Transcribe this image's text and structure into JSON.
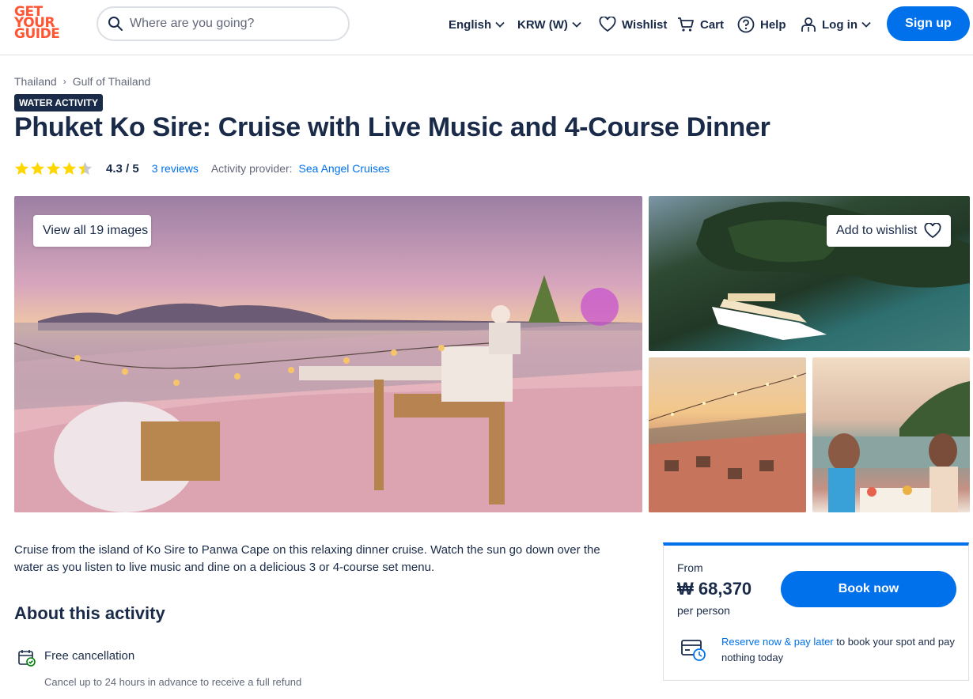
{
  "header": {
    "logo": [
      "GET",
      "YOUR",
      "GUIDE"
    ],
    "search_placeholder": "Where are you going?",
    "language": "English",
    "currency": "KRW (W)",
    "wishlist": "Wishlist",
    "cart": "Cart",
    "help": "Help",
    "login": "Log in",
    "signup": "Sign up"
  },
  "breadcrumb": [
    "Thailand",
    "Gulf of Thailand"
  ],
  "badge": "WATER ACTIVITY",
  "title": "Phuket Ko Sire: Cruise with Live Music and 4-Course Dinner",
  "rating": {
    "stars": 4.3,
    "score": "4.3 / 5",
    "reviews": "3 reviews",
    "provider_label": "Activity provider:",
    "provider": "Sea Angel Cruises"
  },
  "gallery": {
    "view_all": "View all 19 images",
    "add_wishlist": "Add to wishlist"
  },
  "description": "Cruise from the island of Ko Sire to Panwa Cape on this relaxing dinner cruise. Watch the sun go down over the water as you listen to live music and dine on a delicious 3 or 4-course set menu.",
  "about": {
    "heading": "About this activity",
    "features": [
      {
        "title": "Free cancellation",
        "subtitle": "Cancel up to 24 hours in advance to receive a full refund"
      }
    ]
  },
  "booking": {
    "from": "From",
    "price": "₩ 68,370",
    "per_person": "per person",
    "book_now": "Book now",
    "reserve_link": "Reserve now & pay later",
    "reserve_text": " to book your spot and pay nothing today"
  },
  "colors": {
    "brand": "#ff5533",
    "accent": "#0071eb",
    "text": "#1a2b49",
    "star": "#ffd700"
  }
}
